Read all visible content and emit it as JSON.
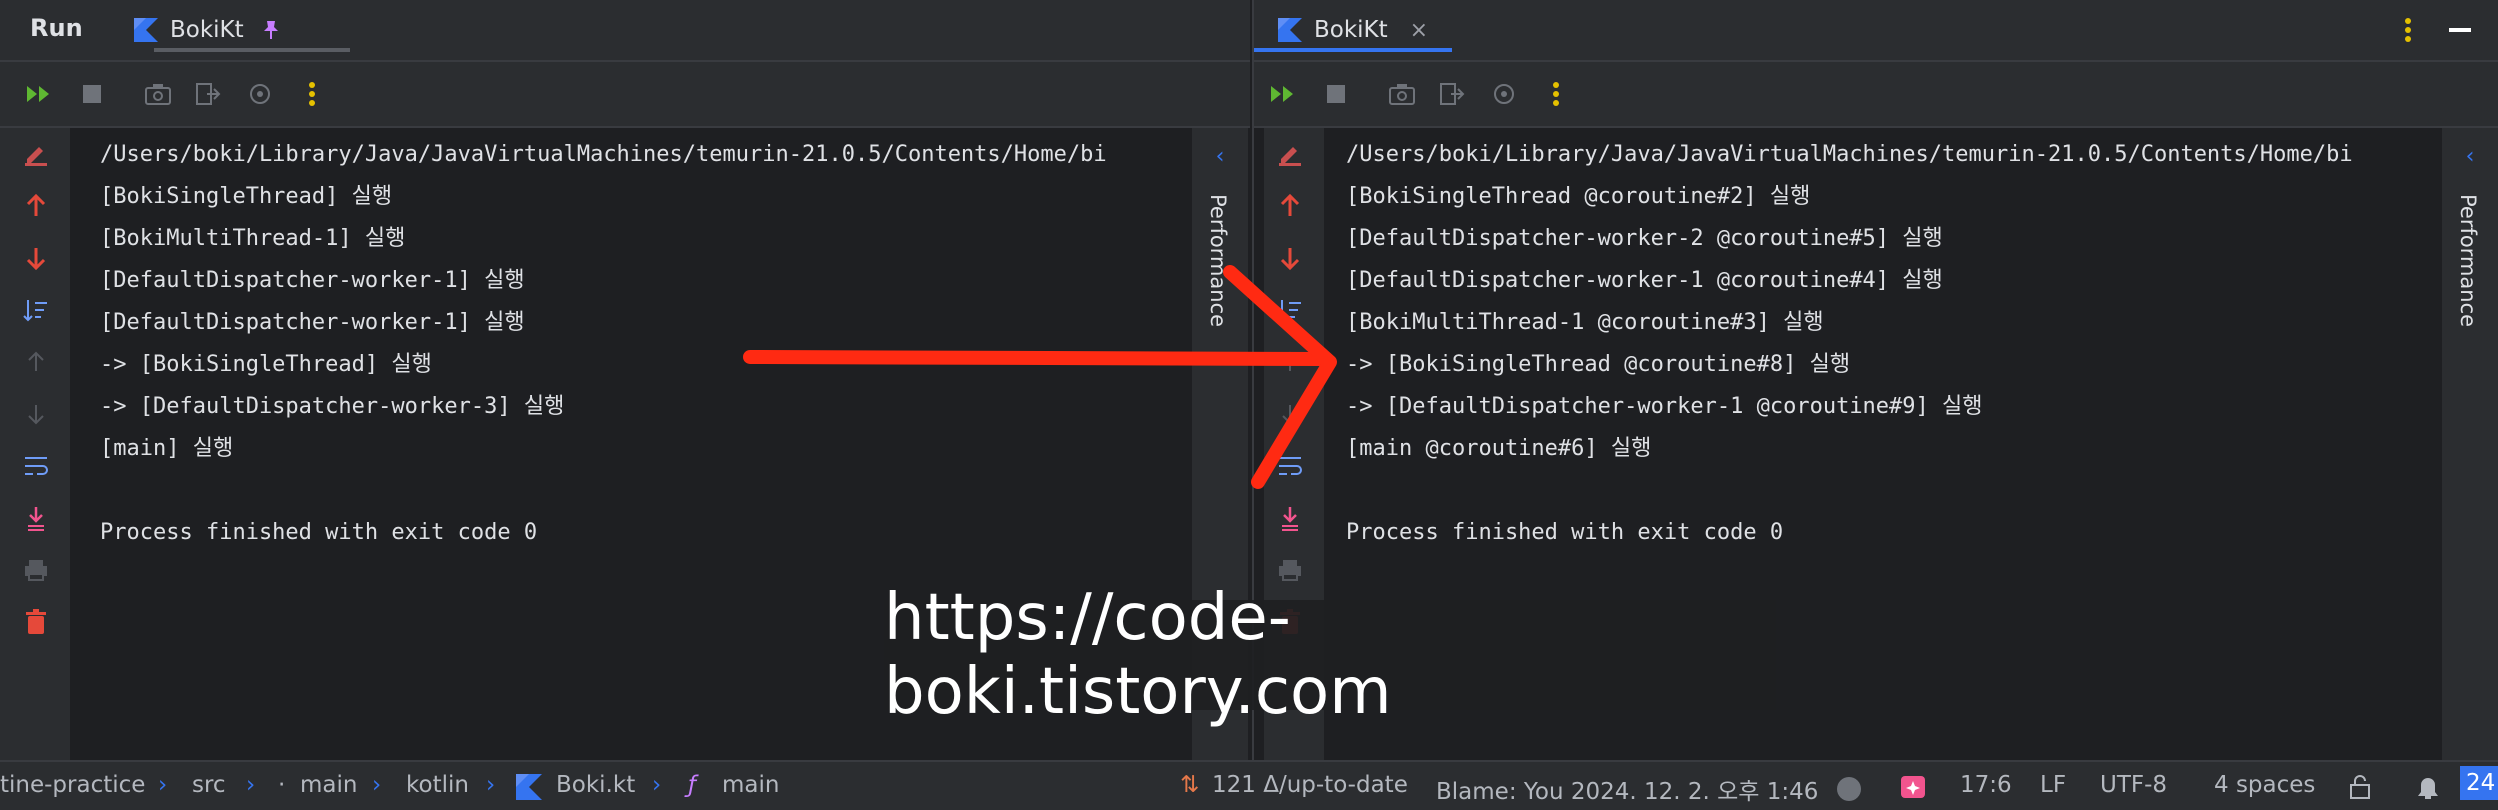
{
  "left": {
    "run_label": "Run",
    "tab_label": "BokiKt",
    "perf_label": "Performance",
    "lines": [
      "/Users/boki/Library/Java/JavaVirtualMachines/temurin-21.0.5/Contents/Home/bi",
      "[BokiSingleThread] 실행",
      "[BokiMultiThread-1] 실행",
      "[DefaultDispatcher-worker-1] 실행",
      "[DefaultDispatcher-worker-1] 실행",
      "-> [BokiSingleThread] 실행",
      "-> [DefaultDispatcher-worker-3] 실행",
      "[main] 실행",
      "",
      "Process finished with exit code 0"
    ]
  },
  "right": {
    "tab_label": "BokiKt",
    "perf_label": "Performance",
    "lines": [
      "/Users/boki/Library/Java/JavaVirtualMachines/temurin-21.0.5/Contents/Home/bi",
      "[BokiSingleThread @coroutine#2] 실행",
      "[DefaultDispatcher-worker-2 @coroutine#5] 실행",
      "[DefaultDispatcher-worker-1 @coroutine#4] 실행",
      "[BokiMultiThread-1 @coroutine#3] 실행",
      "-> [BokiSingleThread @coroutine#8] 실행",
      "-> [DefaultDispatcher-worker-1 @coroutine#9] 실행",
      "[main @coroutine#6] 실행",
      "",
      "Process finished with exit code 0"
    ]
  },
  "watermark": "https://code-boki.tistory.com",
  "statusbar": {
    "crumb_project": "tine-practice",
    "crumb_src": "src",
    "crumb_main": "main",
    "crumb_kotlin": "kotlin",
    "crumb_file": "Boki.kt",
    "crumb_fn": "main",
    "vcs": "121 Δ/up-to-date",
    "blame": "Blame: You 2024. 12. 2. 오후 1:46",
    "position": "17:6",
    "line_sep": "LF",
    "encoding": "UTF-8",
    "indent": "4 spaces",
    "right_badge": "24"
  },
  "colors": {
    "accent": "#3574f0",
    "run_green": "#5fb832",
    "arrow_red": "#ff2a12",
    "kotlin_blue": "#3574f0",
    "trash_red": "#e5493a"
  },
  "icons": {
    "tab_pin": "pin-icon",
    "tab_close": "close-icon",
    "rerun": "rerun-icon",
    "stop": "stop-icon",
    "camera": "camera-icon",
    "exit": "exit-icon",
    "settings": "settings-icon",
    "more": "more-vertical-icon"
  }
}
